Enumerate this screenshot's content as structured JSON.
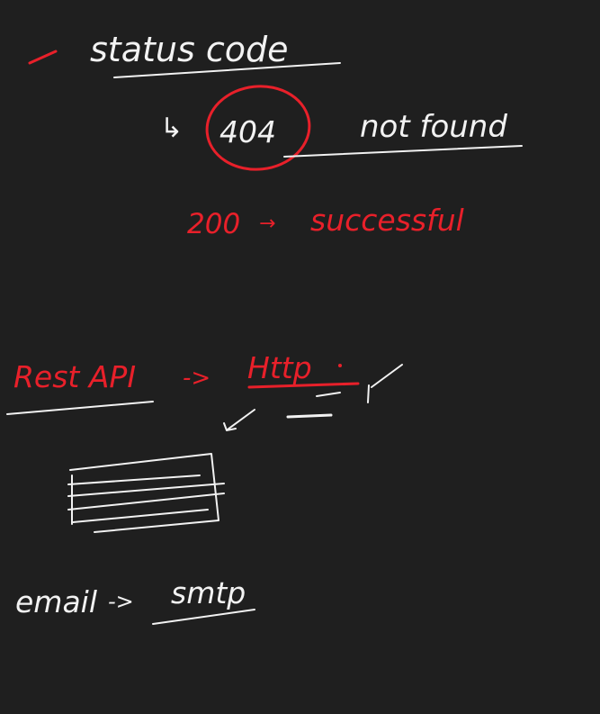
{
  "notes": {
    "bullet_dash": "-",
    "heading": "status code",
    "arrow_symbol": "↳",
    "code_404": "404",
    "not_found": "not found",
    "code_200": "200",
    "arrow_right": "→",
    "successful": "successful",
    "rest_api": "Rest API",
    "arrow_to": "->",
    "http": "Http",
    "email": "email",
    "arrow_email": "->",
    "smtp": "smtp"
  },
  "colors": {
    "background": "#1f1f1f",
    "ink_white": "#f2f2f2",
    "ink_red": "#e8202a"
  }
}
